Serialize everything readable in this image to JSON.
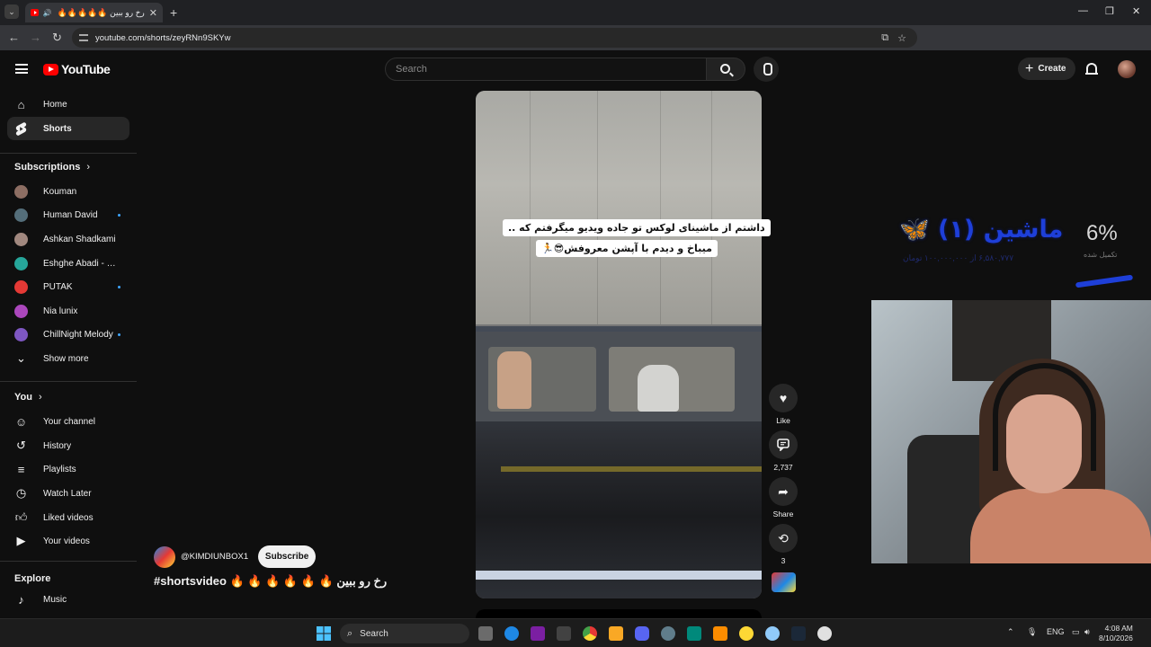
{
  "browser": {
    "tab_title": "رخ رو ببین 🔥🔥🔥🔥🔥",
    "url": "youtube.com/shorts/zeyRNn9SKYw"
  },
  "header": {
    "logo_text": "YouTube",
    "search_placeholder": "Search",
    "create_label": "Create"
  },
  "sidebar": {
    "primary": [
      {
        "label": "Home",
        "icon": "home-icon"
      },
      {
        "label": "Shorts",
        "icon": "shorts-icon",
        "active": true
      }
    ],
    "subscriptions_heading": "Subscriptions",
    "subscriptions": [
      {
        "label": "Kouman",
        "color": "#8d6e63",
        "new": false
      },
      {
        "label": "Human David",
        "color": "#546e7a",
        "new": true
      },
      {
        "label": "Ashkan Shadkami",
        "color": "#a1887f",
        "new": false
      },
      {
        "label": "Eshghe Abadi - عشق ابدی",
        "color": "#26a69a",
        "new": false
      },
      {
        "label": "PUTAK",
        "color": "#e53935",
        "new": true
      },
      {
        "label": "Nia lunix",
        "color": "#ab47bc",
        "new": false
      },
      {
        "label": "ChillNight Melody",
        "color": "#7e57c2",
        "new": true
      }
    ],
    "show_more": "Show more",
    "you_heading": "You",
    "you_items": [
      {
        "label": "Your channel",
        "icon": "channel-icon"
      },
      {
        "label": "History",
        "icon": "history-icon"
      },
      {
        "label": "Playlists",
        "icon": "playlists-icon"
      },
      {
        "label": "Watch Later",
        "icon": "clock-icon"
      },
      {
        "label": "Liked videos",
        "icon": "thumbs-up-icon"
      },
      {
        "label": "Your videos",
        "icon": "play-icon"
      }
    ],
    "explore_heading": "Explore",
    "explore_items": [
      {
        "label": "Music",
        "icon": "music-icon"
      }
    ]
  },
  "short": {
    "caption_line1": "داشتم از ماشینای لوکس تو جاده ویدیو میگرفتم که ..",
    "caption_line2": "میباخ و دیدم با آپشن معروفش😎🏃",
    "channel_handle": "@KIMDIUNBOX1",
    "subscribe_label": "Subscribe",
    "title": "#shortsvideo 🔥 🔥 🔥 🔥 🔥 🔥 رخ رو ببین",
    "actions": {
      "like_label": "Like",
      "comments_count": "2,737",
      "share_label": "Share",
      "remix_count": "3"
    }
  },
  "stream_overlay": {
    "title": "ماشین (۱) 🦋",
    "subtitle": "۶,۵۸۰,۷۷۷ از ۱۰۰,۰۰۰,۰۰۰ تومان",
    "percent": "6%",
    "percent_label": "تکمیل شده",
    "progress": 0.06
  },
  "taskbar": {
    "search_label": "Search",
    "language": "ENG",
    "time": "4:08 AM",
    "date": "8/10/2026"
  }
}
